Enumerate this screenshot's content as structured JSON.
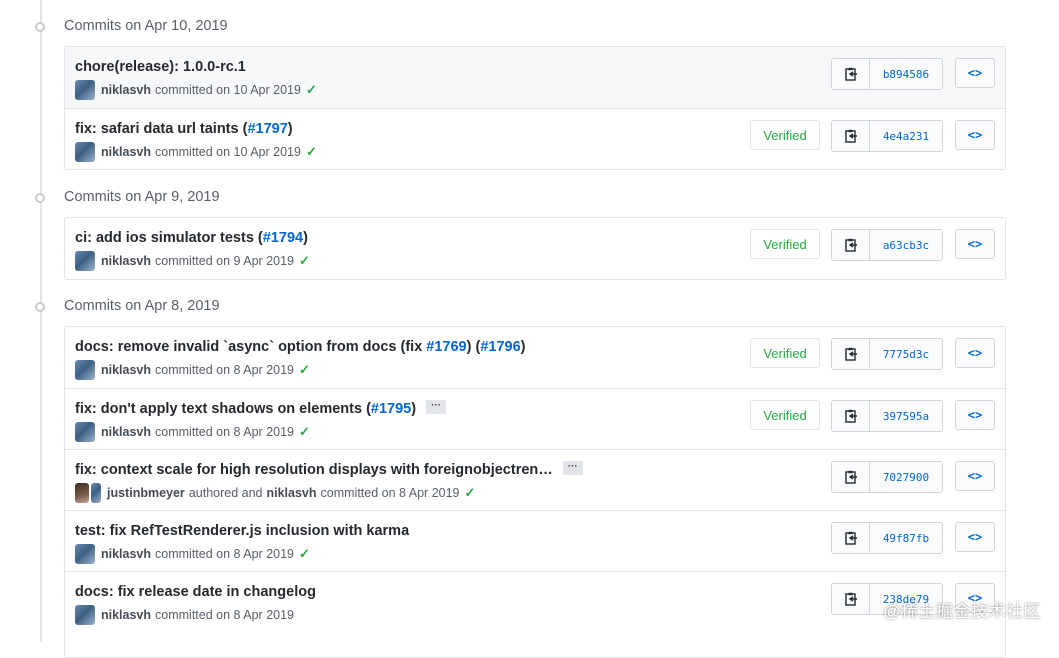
{
  "days": [
    {
      "label": "Commits on Apr 10, 2019"
    },
    {
      "label": "Commits on Apr 9, 2019"
    },
    {
      "label": "Commits on Apr 8, 2019"
    }
  ],
  "commits": [
    {
      "title": "chore(release): 1.0.0-rc.1",
      "user": "niklasvh",
      "action": "committed on 10 Apr 2019",
      "sha": "b894586",
      "check": "✓"
    },
    {
      "title_pre": "fix: safari data url taints (",
      "issue": "#1797",
      "title_post": ")",
      "user": "niklasvh",
      "action": "committed on 10 Apr 2019",
      "verified": "Verified",
      "sha": "4e4a231",
      "check": "✓"
    },
    {
      "title_pre": "ci: add ios simulator tests (",
      "issue": "#1794",
      "title_post": ")",
      "user": "niklasvh",
      "action": "committed on 9 Apr 2019",
      "verified": "Verified",
      "sha": "a63cb3c",
      "check": "✓"
    },
    {
      "title_pre": "docs: remove invalid `async` option from docs (fix ",
      "issue": "#1769",
      "title_mid": ") (",
      "issue2": "#1796",
      "title_post": ")",
      "user": "niklasvh",
      "action": "committed on 8 Apr 2019",
      "verified": "Verified",
      "sha": "7775d3c",
      "check": "✓"
    },
    {
      "title_pre": "fix: don't apply text shadows on elements (",
      "issue": "#1795",
      "title_post": ")",
      "ellipsis": "···",
      "user": "niklasvh",
      "action": "committed on 8 Apr 2019",
      "verified": "Verified",
      "sha": "397595a",
      "check": "✓"
    },
    {
      "title": "fix: context scale for high resolution displays with foreignobjectren…",
      "ellipsis": "···",
      "author": "justinbmeyer",
      "authored": "authored and",
      "user": "niklasvh",
      "action": "committed on 8 Apr 2019",
      "sha": "7027900",
      "check": "✓"
    },
    {
      "title": "test: fix RefTestRenderer.js inclusion with karma",
      "user": "niklasvh",
      "action": "committed on 8 Apr 2019",
      "sha": "49f87fb",
      "check": "✓"
    },
    {
      "title": "docs: fix release date in changelog",
      "user": "niklasvh",
      "action": "committed on 8 Apr 2019",
      "sha": "238de79"
    }
  ],
  "browse_icon": "code-icon",
  "copy_icon": "clipboard-icon",
  "watermark": "@稀土掘金技术社区"
}
